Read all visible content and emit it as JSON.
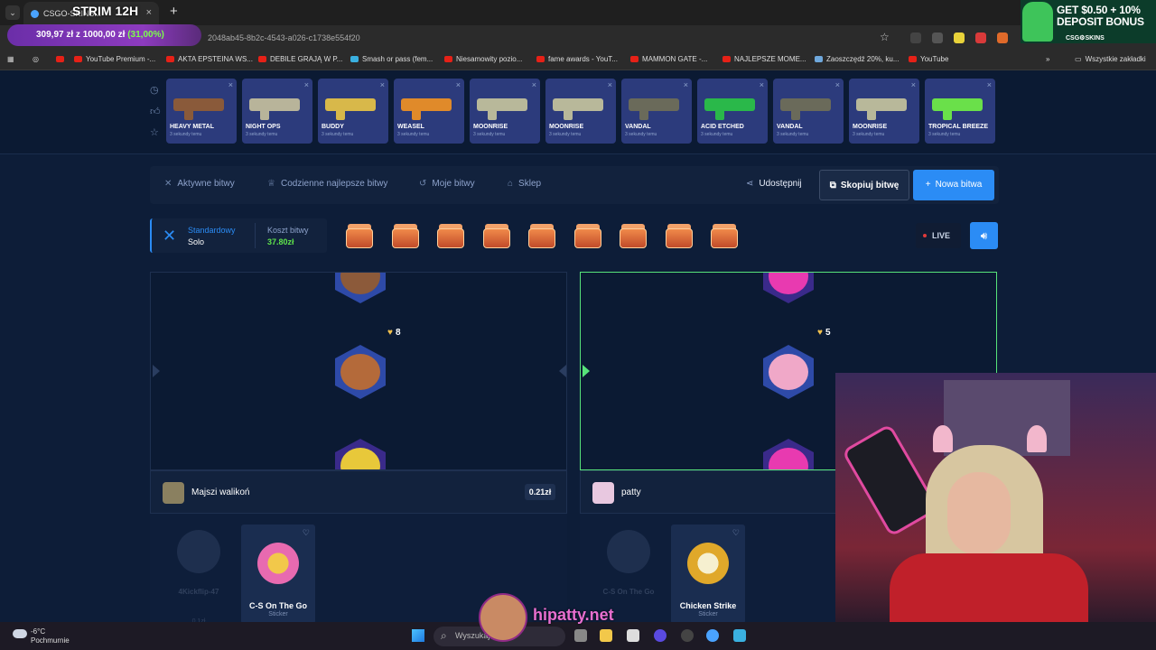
{
  "browser": {
    "tab_title": "CSGO-SKINS...",
    "url": "2048ab45-8b2c-4543-a026-c1738e554f20",
    "bookmarks": [
      {
        "label": "YouTube Premium -..."
      },
      {
        "label": "AKTA EPSTEINA WS..."
      },
      {
        "label": "DEBILE GRAJĄ W P..."
      },
      {
        "label": "Smash or pass (fem..."
      },
      {
        "label": "Niesamowity pozio..."
      },
      {
        "label": "fame awards - YouT..."
      },
      {
        "label": "MAMMON GATE -..."
      },
      {
        "label": "NAJLEPSZE MOME..."
      },
      {
        "label": "Zaoszczędź 20%, ku..."
      },
      {
        "label": "YouTube"
      }
    ],
    "all_bookmarks": "Wszystkie zakładki"
  },
  "stream": {
    "title": "STRIM 12H",
    "goal_current": "309,97 zł",
    "goal_mid": " z ",
    "goal_target": "1000,00 zł",
    "goal_pct": " (31,00%)",
    "watermark": "hipatty.net"
  },
  "promo": {
    "line1": "GET $0.50 + 10%",
    "line2": "DEPOSIT BONUS",
    "brand": "CSG⚙SKINS"
  },
  "live_feed": {
    "items": [
      {
        "name": "HEAVY METAL",
        "sub": "3 sekundy temu",
        "color": "#8a5a3a"
      },
      {
        "name": "NIGHT OPS",
        "sub": "3 sekundy temu",
        "color": "#b8b49a"
      },
      {
        "name": "BUDDY",
        "sub": "3 sekundy temu",
        "color": "#d8b84a"
      },
      {
        "name": "WEASEL",
        "sub": "3 sekundy temu",
        "color": "#e08a2a"
      },
      {
        "name": "MOONRISE",
        "sub": "3 sekundy temu",
        "color": "#b8b89a"
      },
      {
        "name": "MOONRISE",
        "sub": "3 sekundy temu",
        "color": "#b8b89a"
      },
      {
        "name": "VANDAL",
        "sub": "3 sekundy temu",
        "color": "#6a6a5a"
      },
      {
        "name": "ACID ETCHED",
        "sub": "3 sekundy temu",
        "color": "#2ab84a"
      },
      {
        "name": "VANDAL",
        "sub": "3 sekundy temu",
        "color": "#6a6a5a"
      },
      {
        "name": "MOONRISE",
        "sub": "3 sekundy temu",
        "color": "#b8b89a"
      },
      {
        "name": "TROPICAL BREEZE",
        "sub": "3 sekundy temu",
        "color": "#6ae04a"
      }
    ]
  },
  "nav": {
    "active": "Aktywne bitwy",
    "daily": "Codzienne najlepsze bitwy",
    "mine": "Moje bitwy",
    "shop": "Sklep",
    "share": "Udostępnij",
    "copy": "Skopiuj bitwę",
    "new": "Nowa bitwa"
  },
  "battle": {
    "mode_label": "Standardowy",
    "mode_value": "Solo",
    "cost_label": "Koszt bitwy",
    "cost_value": "37.80zł",
    "case_count": 9,
    "live": "LIVE"
  },
  "players": [
    {
      "name": "Majszi walikoń",
      "lives": "8",
      "value": "0.21zł",
      "ghost_name": "4Kickflip-47",
      "ghost_price": "0.1zł",
      "card_name": "C-S On The Go",
      "card_type": "Sticker"
    },
    {
      "name": "patty",
      "lives": "5",
      "value": "",
      "ghost_name": "C-S On The Go",
      "ghost_price": "",
      "card_name": "Chicken Strike",
      "card_type": "Sticker"
    }
  ],
  "taskbar": {
    "temp": "-6°C",
    "condition": "Pochmurnie",
    "search": "Wyszukaj"
  }
}
